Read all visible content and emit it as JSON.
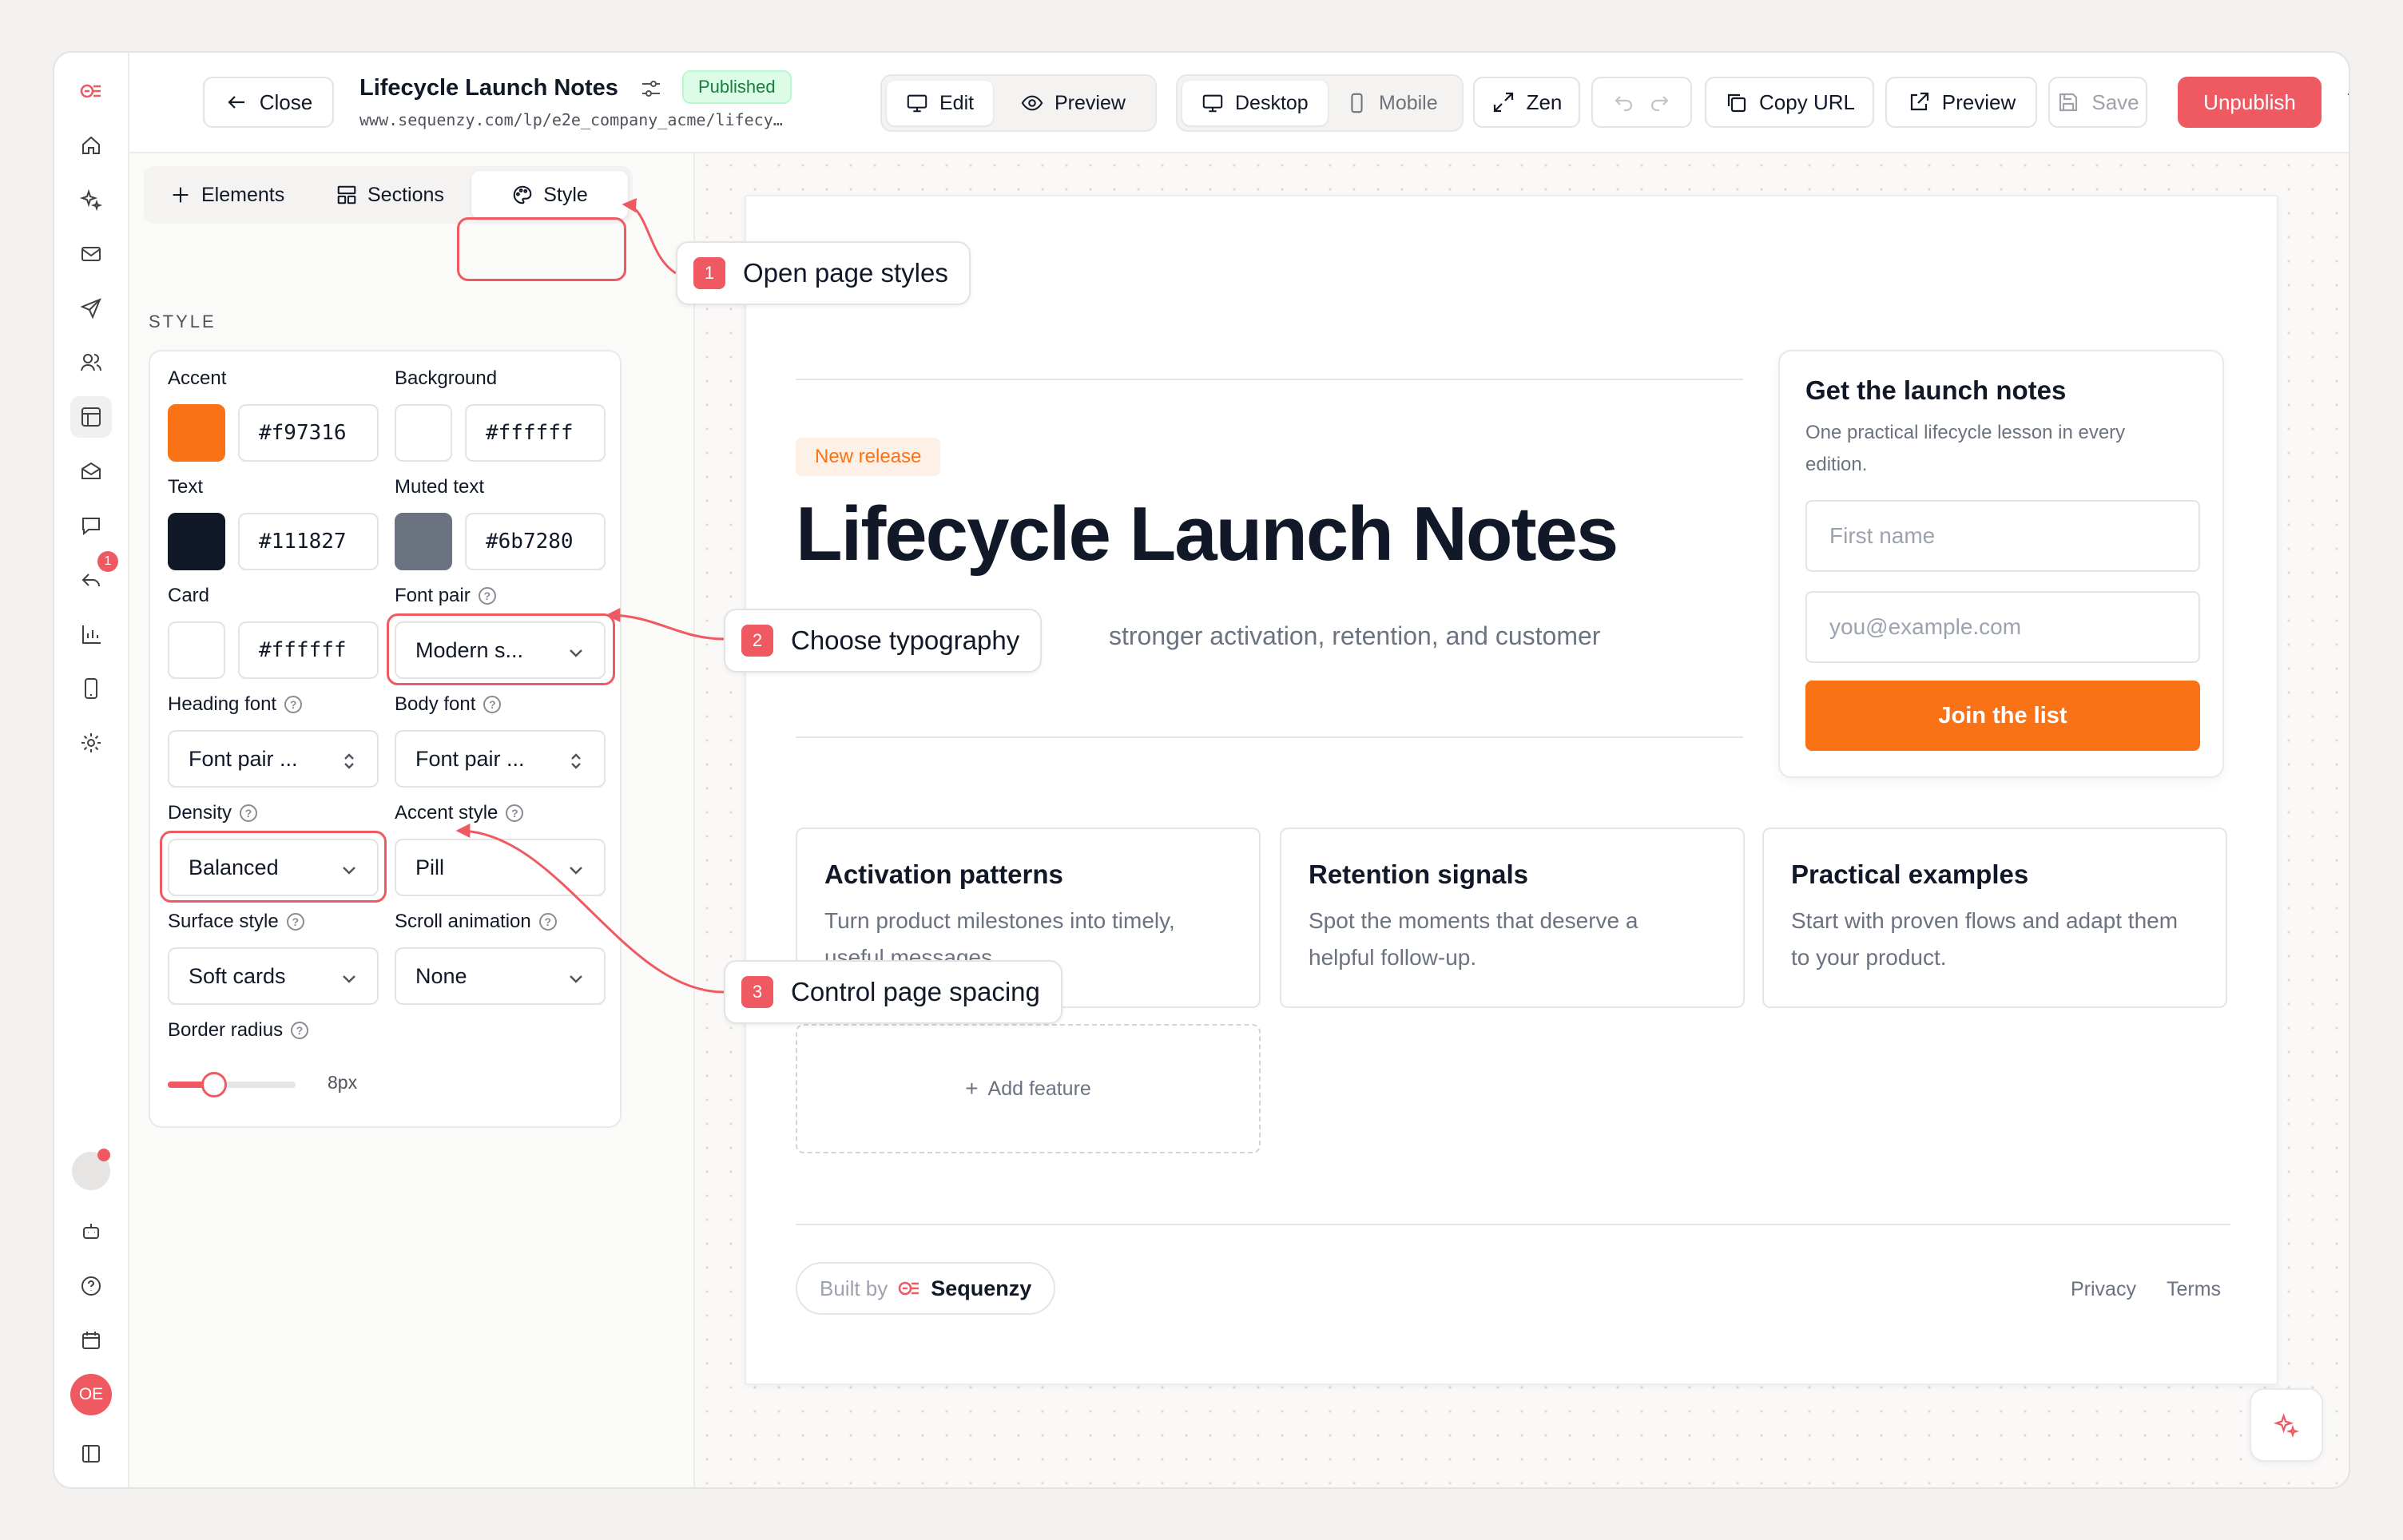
{
  "topbar": {
    "close_label": "Close",
    "page_title": "Lifecycle Launch Notes",
    "status_badge": "Published",
    "url": "www.sequenzy.com/lp/e2e_company_acme/lifecy…",
    "mode_tabs": [
      "Edit",
      "Preview"
    ],
    "device_tabs": [
      "Desktop",
      "Mobile"
    ],
    "zen_label": "Zen",
    "copy_url_label": "Copy URL",
    "preview_label": "Preview",
    "save_label": "Save",
    "unpublish_label": "Unpublish"
  },
  "rail": {
    "notification_count": "1",
    "avatar_initials": "OE"
  },
  "panel": {
    "tabs": [
      "Elements",
      "Sections",
      "Style"
    ],
    "section_title": "STYLE",
    "accent": {
      "label": "Accent",
      "value": "#f97316"
    },
    "background": {
      "label": "Background",
      "value": "#ffffff"
    },
    "text": {
      "label": "Text",
      "value": "#111827"
    },
    "muted": {
      "label": "Muted text",
      "value": "#6b7280"
    },
    "card": {
      "label": "Card",
      "value": "#ffffff"
    },
    "font_pair": {
      "label": "Font pair",
      "value": "Modern s..."
    },
    "heading_font": {
      "label": "Heading font",
      "value": "Font pair ..."
    },
    "body_font": {
      "label": "Body font",
      "value": "Font pair ..."
    },
    "density": {
      "label": "Density",
      "value": "Balanced"
    },
    "accent_style": {
      "label": "Accent style",
      "value": "Pill"
    },
    "surface_style": {
      "label": "Surface style",
      "value": "Soft cards"
    },
    "scroll_animation": {
      "label": "Scroll animation",
      "value": "None"
    },
    "border_radius": {
      "label": "Border radius",
      "value": "8px"
    }
  },
  "preview": {
    "badge": "New release",
    "headline": "Lifecycle Launch Notes",
    "lede": "stronger activation, retention, and customer",
    "signup": {
      "title": "Get the launch notes",
      "description": "One practical lifecycle lesson in every edition.",
      "first_name_placeholder": "First name",
      "email_placeholder": "you@example.com",
      "button": "Join the list"
    },
    "features": [
      {
        "title": "Activation patterns",
        "description": "Turn product milestones into timely, useful messages."
      },
      {
        "title": "Retention signals",
        "description": "Spot the moments that deserve a helpful follow-up."
      },
      {
        "title": "Practical examples",
        "description": "Start with proven flows and adapt them to your product."
      }
    ],
    "add_feature": "Add feature",
    "footer": {
      "built_by": "Built by",
      "brand": "Sequenzy",
      "links": [
        "Privacy",
        "Terms"
      ]
    }
  },
  "callouts": [
    {
      "number": "1",
      "text": "Open page styles"
    },
    {
      "number": "2",
      "text": "Choose typography"
    },
    {
      "number": "3",
      "text": "Control page spacing"
    }
  ],
  "colors": {
    "brand": "#ef5a62",
    "accent": "#f97316",
    "published_bg": "#dcfce7"
  }
}
